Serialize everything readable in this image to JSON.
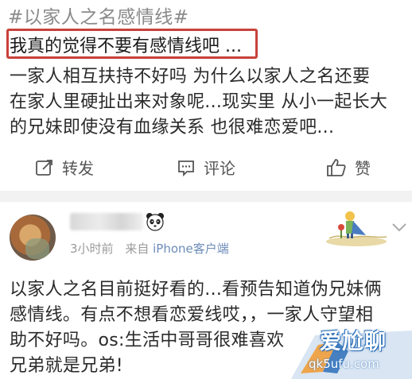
{
  "post1": {
    "topic": "#以家人之名感情线#",
    "highlight": "我真的觉得不要有感情线吧 ...",
    "body_lines": [
      "一家人相互扶持不好吗 为什么以家人之名还要",
      "在家人里硬扯出来对象呢...现实里 从小一起长大",
      "的兄妹即使没有血缘关系 也很难恋爱吧..."
    ],
    "actions": {
      "repost": "转发",
      "comment": "评论",
      "like": "赞"
    }
  },
  "post2": {
    "time": "3小时前",
    "source_prefix": "来自",
    "source_device": "iPhone客户端",
    "body_lines": [
      "以家人之名目前挺好看的...看预告知道伪兄妹俩",
      "感情线。有点不想看恋爱线哎，，一家人守望相",
      "助不好吗。os:生活中哥哥很难喜欢",
      "兄弟就是兄弟!"
    ]
  },
  "watermark": {
    "title": "爱尬聊",
    "url": "qk5ufu.com"
  },
  "colors": {
    "highlight_border": "#c8423a",
    "topic_gray": "#8a8a8a",
    "link_blue": "#6c8cb8",
    "watermark_blue": "#2b6fb8"
  }
}
